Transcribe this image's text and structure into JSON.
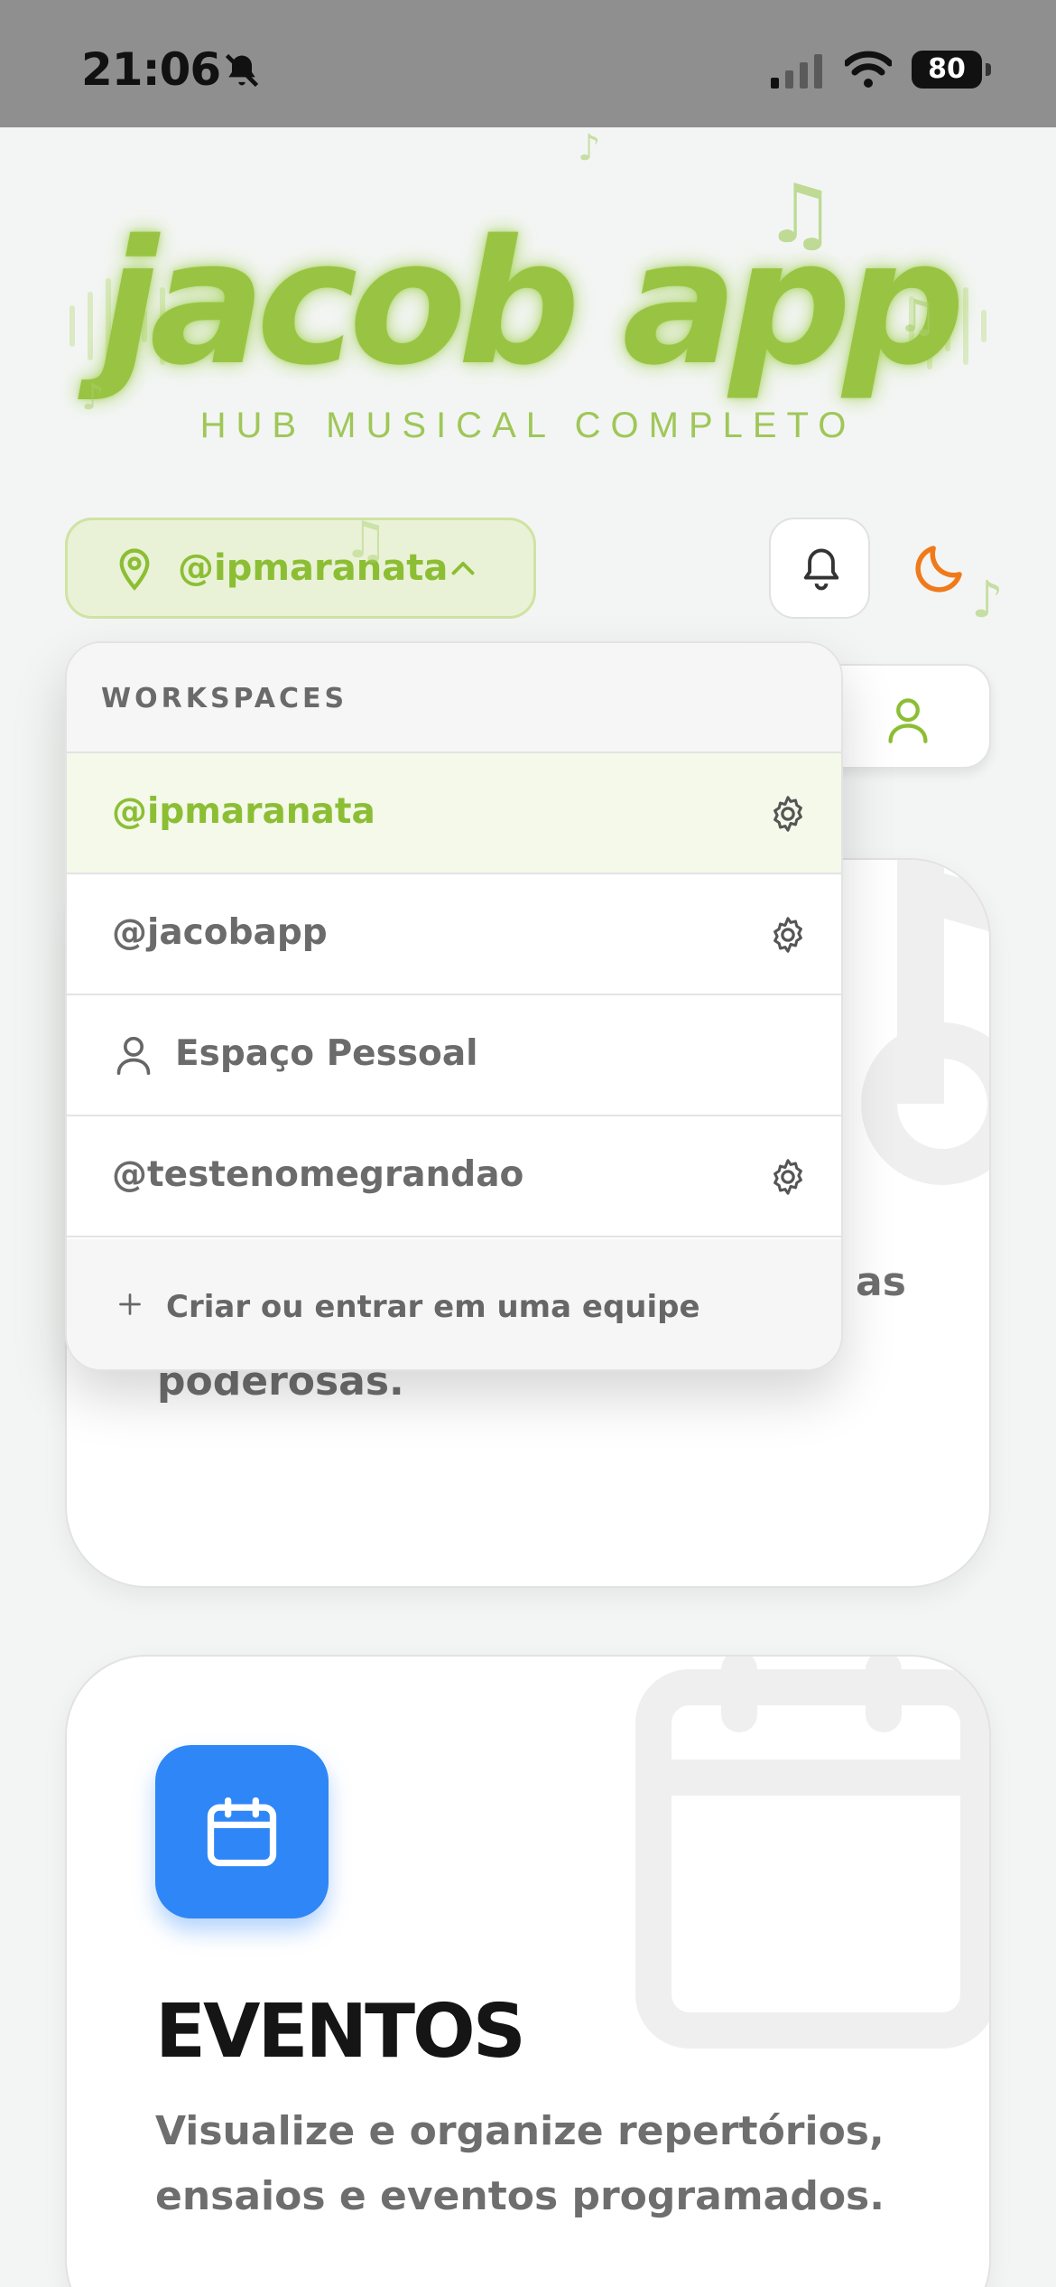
{
  "status_bar": {
    "time": "21:06",
    "battery": "80"
  },
  "logo": {
    "title": "jacob app",
    "subtitle": "HUB MUSICAL COMPLETO"
  },
  "header": {
    "workspace_selector_label": "@ipmaranata"
  },
  "dropdown": {
    "header": "WORKSPACES",
    "items": [
      {
        "label": "@ipmaranata",
        "active": true
      },
      {
        "label": "@jacobapp"
      },
      {
        "label": "Espaço Pessoal"
      },
      {
        "label": "@testenomegrandao"
      }
    ],
    "footer": "Criar ou entrar em uma equipe"
  },
  "cards": [
    {
      "desc_tail": "as",
      "description": "e letras e use ferramentas poderosas."
    },
    {
      "title": "EVENTOS",
      "description": "Visualize e organize repertórios, ensaios e eventos programados."
    }
  ],
  "colors": {
    "brand_green": "#99c443",
    "accent_orange": "#f07a1a",
    "event_blue": "#2f86f6"
  },
  "icons": {
    "mute": "bell-slash-icon",
    "location": "map-pin-icon",
    "notifications": "bell-icon",
    "theme": "moon-icon",
    "profile": "user-icon",
    "workspace_settings": "gear-icon",
    "calendar": "calendar-icon",
    "music": "music-note-icon"
  }
}
